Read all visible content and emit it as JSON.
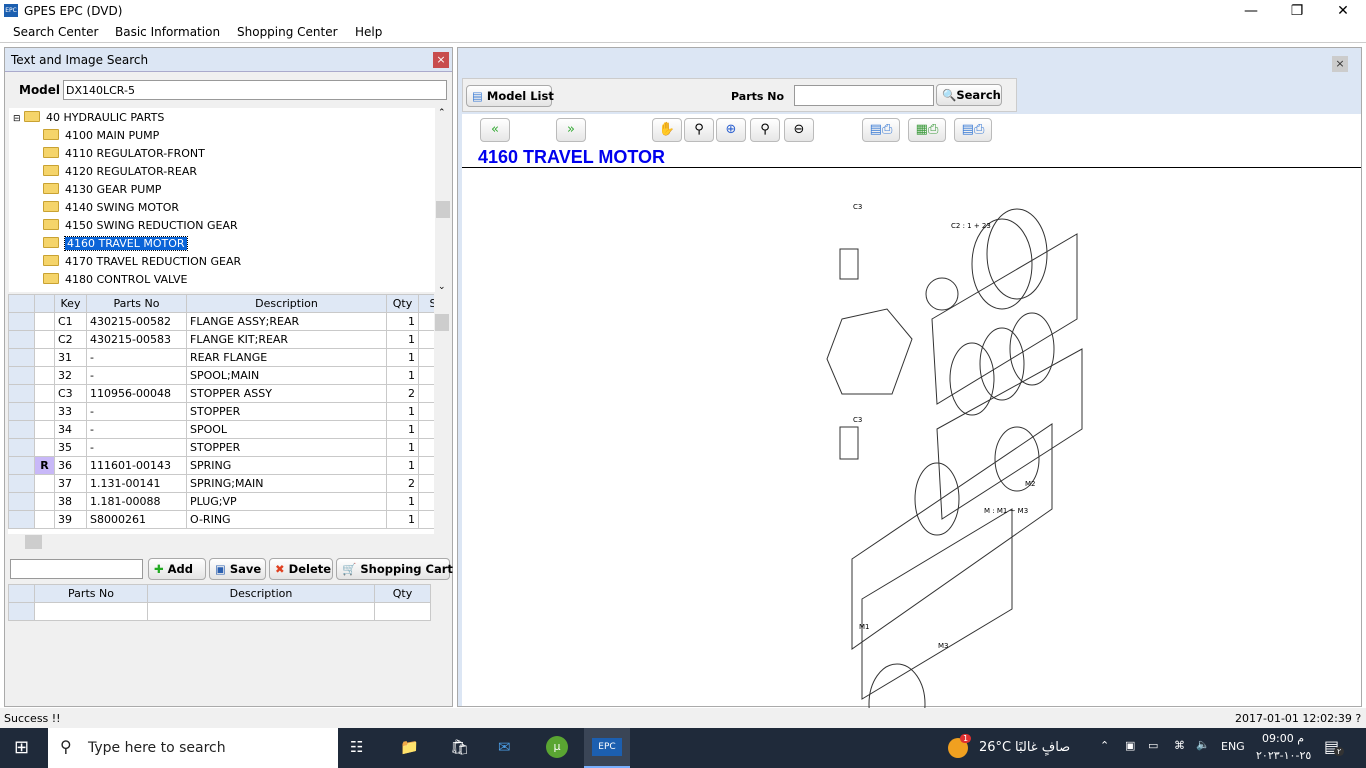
{
  "window": {
    "title": "GPES EPC (DVD)",
    "app_icon": "EPC"
  },
  "menu": [
    "Search Center",
    "Basic Information",
    "Shopping Center",
    "Help"
  ],
  "left_panel": {
    "title": "Text and Image Search",
    "model_label": "Model",
    "model_value": "DX140LCR-5",
    "tree": {
      "root": "40 HYDRAULIC PARTS",
      "items": [
        "4100 MAIN PUMP",
        "4110 REGULATOR-FRONT",
        "4120 REGULATOR-REAR",
        "4130 GEAR PUMP",
        "4140 SWING MOTOR",
        "4150 SWING REDUCTION GEAR",
        "4160 TRAVEL MOTOR",
        "4170 TRAVEL REDUCTION GEAR",
        "4180 CONTROL VALVE"
      ],
      "selected": "4160 TRAVEL MOTOR"
    },
    "parts_table": {
      "headers": [
        "Key",
        "Parts No",
        "Description",
        "Qty",
        "S"
      ],
      "rows": [
        {
          "flag": "",
          "key": "C1",
          "parts_no": "430215-00582",
          "desc": "FLANGE ASSY;REAR",
          "qty": "1"
        },
        {
          "flag": "",
          "key": "C2",
          "parts_no": "430215-00583",
          "desc": "FLANGE KIT;REAR",
          "qty": "1"
        },
        {
          "flag": "",
          "key": "31",
          "parts_no": "-",
          "desc": "REAR FLANGE",
          "qty": "1"
        },
        {
          "flag": "",
          "key": "32",
          "parts_no": "-",
          "desc": "SPOOL;MAIN",
          "qty": "1"
        },
        {
          "flag": "",
          "key": "C3",
          "parts_no": "110956-00048",
          "desc": "STOPPER ASSY",
          "qty": "2"
        },
        {
          "flag": "",
          "key": "33",
          "parts_no": "-",
          "desc": "STOPPER",
          "qty": "1"
        },
        {
          "flag": "",
          "key": "34",
          "parts_no": "-",
          "desc": "SPOOL",
          "qty": "1"
        },
        {
          "flag": "",
          "key": "35",
          "parts_no": "-",
          "desc": "STOPPER",
          "qty": "1"
        },
        {
          "flag": "R",
          "key": "36",
          "parts_no": "111601-00143",
          "desc": "SPRING",
          "qty": "1"
        },
        {
          "flag": "",
          "key": "37",
          "parts_no": "1.131-00141",
          "desc": "SPRING;MAIN",
          "qty": "2"
        },
        {
          "flag": "",
          "key": "38",
          "parts_no": "1.181-00088",
          "desc": "PLUG;VP",
          "qty": "1"
        },
        {
          "flag": "",
          "key": "39",
          "parts_no": "S8000261",
          "desc": "O-RING",
          "qty": "1"
        }
      ]
    },
    "cart_input_value": "",
    "buttons": {
      "add": "Add",
      "save": "Save",
      "delete": "Delete",
      "cart": "Shopping Cart"
    },
    "cart_table": {
      "headers": [
        "Parts No",
        "Description",
        "Qty"
      ]
    }
  },
  "right_panel": {
    "model_list": "Model List",
    "parts_no_label": "Parts No",
    "parts_no_value": "",
    "search": "Search",
    "title": "4160 TRAVEL MOTOR",
    "diagram_labels": {
      "c2": "C2 : 1 + 23",
      "m": "M : M1 ~ M3",
      "m1": "M1",
      "m2": "M2",
      "m3": "M3",
      "c3a": "C3",
      "c3b": "C3"
    }
  },
  "status": {
    "message": "Success !!",
    "datetime": "2017-01-01 12:02:39 ?"
  },
  "taskbar": {
    "search_placeholder": "Type here to search",
    "temp": "26°C",
    "weather": "صافٍ غالبًا",
    "weather_badge": "1",
    "lang": "ENG",
    "time": "09:00 م",
    "date": "٢٥-١٠-٢٠٢٣",
    "notif_badge": "٢"
  },
  "colors": {
    "title_blue": "#0000ee",
    "selection": "#0a64d8",
    "panel_header": "#dce6f4",
    "taskbar": "#1f2a3a"
  }
}
